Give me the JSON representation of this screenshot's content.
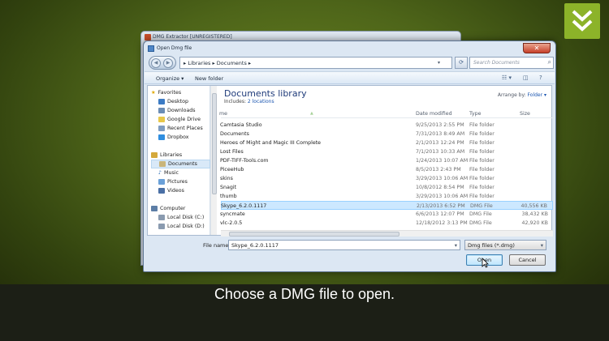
{
  "parent_window": {
    "title": "DMG Extractor [UNREGISTERED]"
  },
  "dialog": {
    "title": "Open Dmg file",
    "close_glyph": "✕",
    "address": {
      "path": "▸ Libraries ▸ Documents ▸",
      "dropdown": "▾"
    },
    "search_placeholder": "Search Documents",
    "command_bar": {
      "organize": "Organize ▾",
      "new_folder": "New folder"
    },
    "nav": {
      "favorites_header": "Favorites",
      "favorites": [
        "Desktop",
        "Downloads",
        "Google Drive",
        "Recent Places",
        "Dropbox"
      ],
      "libraries_header": "Libraries",
      "libraries": [
        "Documents",
        "Music",
        "Pictures",
        "Videos"
      ],
      "computer_header": "Computer",
      "drives": [
        "Local Disk (C:)",
        "Local Disk (D:)"
      ]
    },
    "library": {
      "title": "Documents library",
      "includes_label": "Includes: ",
      "includes_link": "2 locations",
      "arrange_label": "Arrange by: ",
      "arrange_value": "Folder ▾"
    },
    "columns": {
      "name": "me",
      "date": "Date modified",
      "type": "Type",
      "size": "Size"
    },
    "files": [
      {
        "name": "Camtasia Studio",
        "date": "9/25/2013 2:55 PM",
        "type": "File folder",
        "size": ""
      },
      {
        "name": "Documents",
        "date": "7/31/2013 8:49 AM",
        "type": "File folder",
        "size": ""
      },
      {
        "name": "Heroes of Might and Magic III Complete",
        "date": "2/1/2013 12:24 PM",
        "type": "File folder",
        "size": ""
      },
      {
        "name": "Lost Files",
        "date": "7/1/2013 10:33 AM",
        "type": "File folder",
        "size": ""
      },
      {
        "name": "PDF-TIFF-Tools.com",
        "date": "1/24/2013 10:07 AM",
        "type": "File folder",
        "size": ""
      },
      {
        "name": "PiceeHub",
        "date": "8/5/2013 2:43 PM",
        "type": "File folder",
        "size": ""
      },
      {
        "name": "skins",
        "date": "3/29/2013 10:06 AM",
        "type": "File folder",
        "size": ""
      },
      {
        "name": "Snagit",
        "date": "10/8/2012 8:54 PM",
        "type": "File folder",
        "size": ""
      },
      {
        "name": "thumb",
        "date": "3/29/2013 10:06 AM",
        "type": "File folder",
        "size": ""
      },
      {
        "name": "Skype_6.2.0.1117",
        "date": "2/13/2013 6:52 PM",
        "type": "DMG File",
        "size": "40,556 KB"
      },
      {
        "name": "syncmate",
        "date": "6/6/2013 12:07 PM",
        "type": "DMG File",
        "size": "38,432 KB"
      },
      {
        "name": "vlc-2.0.5",
        "date": "12/18/2012 3:13 PM",
        "type": "DMG File",
        "size": "42,920 KB"
      }
    ],
    "selected_index": 9,
    "file_name_label": "File name:",
    "file_name_value": "Skype_6.2.0.1117",
    "file_type_value": "Dmg files (*.dmg)",
    "open_label": "Open",
    "cancel_label": "Cancel"
  },
  "caption": "Choose a DMG file to open.",
  "colors": {
    "logo_green": "#8cb329",
    "selection": "#cce8ff",
    "link": "#1a55b0",
    "title_blue": "#1f3b7a"
  }
}
